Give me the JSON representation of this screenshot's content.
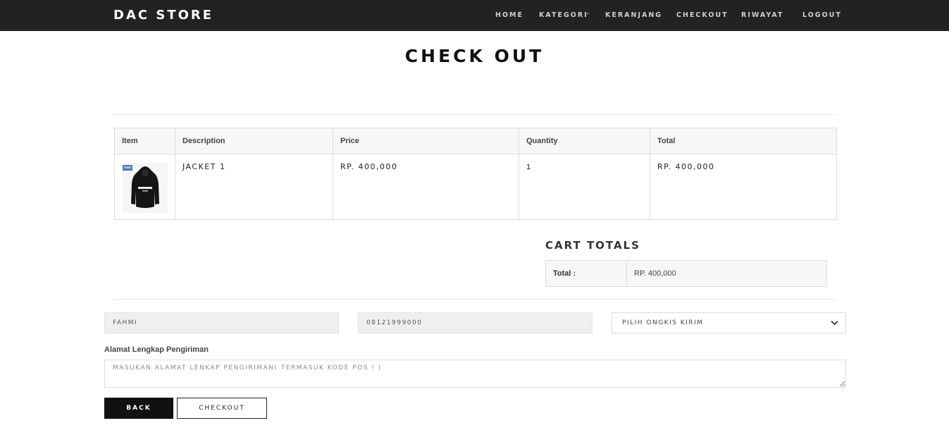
{
  "navbar": {
    "brand": "DAC STORE",
    "items": [
      {
        "label": "HOME"
      },
      {
        "label": "KATEGORI"
      },
      {
        "label": "KERANJANG"
      },
      {
        "label": "CHECKOUT"
      },
      {
        "label": "RIWAYAT"
      },
      {
        "label": "LOGOUT"
      }
    ],
    "dropdown_icon": "chevron-down-icon"
  },
  "page": {
    "title": "CHECK OUT"
  },
  "cart": {
    "headers": [
      "Item",
      "Description",
      "Price",
      "Quantity",
      "Total"
    ],
    "rows": [
      {
        "image": "black-hoodie-product-image",
        "description": "JACKET 1",
        "price": "RP. 400,000",
        "quantity": "1",
        "total": "RP. 400,000"
      }
    ]
  },
  "totals": {
    "title": "CART TOTALS",
    "label": "Total :",
    "value": "RP. 400,000"
  },
  "form": {
    "name_value": "FAHMI",
    "phone_value": "08121999000",
    "shipping_selected": "PILIH ONGKIS KIRIM",
    "address_label": "Alamat Lengkap Pengiriman",
    "address_placeholder": "MASUKAN ALAMAT LENKAP PENGIRIMAN( TERMASUK KODE POS ! )",
    "back_label": "BACK",
    "checkout_label": "CHECKOUT"
  },
  "colors": {
    "navbar_bg": "#222222",
    "nav_text": "#cfcfcf",
    "table_header_bg": "#f7f7f7",
    "readonly_field_bg": "#efefef",
    "back_button_bg": "#111111"
  }
}
